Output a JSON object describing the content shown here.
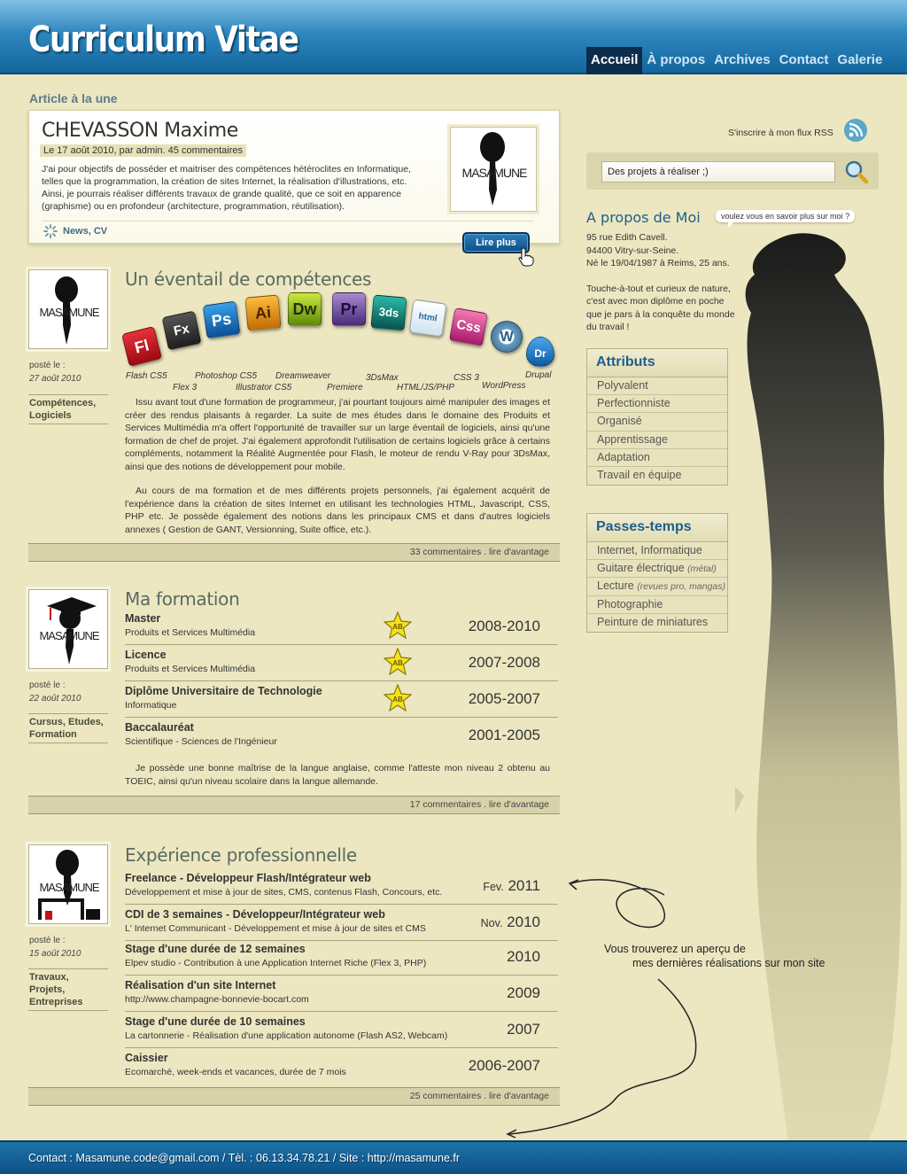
{
  "header": {
    "title": "Curriculum Vitae"
  },
  "nav": [
    {
      "label": "Accueil",
      "active": true
    },
    {
      "label": "À propos"
    },
    {
      "label": "Archives"
    },
    {
      "label": "Contact"
    },
    {
      "label": "Galerie"
    }
  ],
  "featured": {
    "section_label": "Article à la une",
    "name": "CHEVASSON Maxime",
    "meta": "Le 17 août 2010, par admin. 45 commentaires",
    "text": "J'ai pour objectifs de posséder et maitriser des compétences hétéroclites en Informatique, telles que la programmation, la création de sites Internet, la réalisation d'illustrations, etc. Ainsi, je pourrais réaliser différents travaux de grande qualité, que ce soit en apparence (graphisme) ou en profondeur (architecture, programmation, réutilisation).",
    "tags": "News, CV",
    "logo_text": "MASAMUNE",
    "more_button": "Lire plus"
  },
  "posts": {
    "skills": {
      "title": "Un éventail de compétences",
      "posted_label": "posté le :",
      "date": "27 août 2010",
      "category": "Compétences, Logiciels",
      "logo_text": "MASAMUNE",
      "icons": [
        {
          "abbr": "Fl",
          "label": "Flash CS5",
          "color": "#c8101a"
        },
        {
          "abbr": "Fx",
          "label": "Flex 3",
          "color": "#333333"
        },
        {
          "abbr": "Ps",
          "label": "Photoshop CS5",
          "color": "#1c78c8"
        },
        {
          "abbr": "Ai",
          "label": "Illustrator CS5",
          "color": "#e8920c"
        },
        {
          "abbr": "Dw",
          "label": "Dreamweaver",
          "color": "#8fb51a"
        },
        {
          "abbr": "Pr",
          "label": "Premiere",
          "color": "#7a5aa8"
        },
        {
          "abbr": "3ds",
          "label": "3DsMax",
          "color": "#12827a"
        },
        {
          "abbr": "html",
          "label": "HTML/JS/PHP",
          "color": "#7fb4d8"
        },
        {
          "abbr": "Css",
          "label": "CSS 3",
          "color": "#d83a8a"
        },
        {
          "abbr": "W",
          "label": "WordPress",
          "color": "#3f7ea8"
        },
        {
          "abbr": "Dr",
          "label": "Drupal",
          "color": "#1e78c4"
        }
      ],
      "paragraph1": "Issu avant tout d'une formation de programmeur, j'ai pourtant toujours aimé manipuler des images et créer des rendus plaisants à regarder. La suite de mes études dans le domaine des Produits et Services Multimédia m'a offert l'opportunité de travailler sur un large éventail de logiciels, ainsi qu'une formation de chef de projet. J'ai également approfondit l'utilisation de certains logiciels grâce à certains compléments, notamment la Réalité Augmentée pour Flash, le moteur de rendu V-Ray pour 3DsMax, ainsi que des notions de développement pour mobile.",
      "paragraph2": "Au cours de ma formation et de mes différents projets personnels, j'ai également acquérit de l'expérience dans la création de sites Internet en utilisant les technologies HTML, Javascript, CSS, PHP etc.  Je possède également des notions  dans les principaux CMS et dans d'autres logiciels annexes ( Gestion de GANT, Versionning, Suite office, etc.).",
      "footer": "33 commentaires . lire d'avantage"
    },
    "formation": {
      "title": "Ma formation",
      "posted_label": "posté le :",
      "date": "22 août 2010",
      "category": "Cursus, Etudes, Formation",
      "logo_text": "MASAMUNE",
      "rows": [
        {
          "title": "Master",
          "subtitle": "Produits et Services Multimédia",
          "years": "2008-2010",
          "badge": "AB"
        },
        {
          "title": "Licence",
          "subtitle": "Produits et Services Multimédia",
          "years": "2007-2008",
          "badge": "AB"
        },
        {
          "title": "Diplôme Universitaire de Technologie",
          "subtitle": "Informatique",
          "years": "2005-2007",
          "badge": "AB"
        },
        {
          "title": "Baccalauréat",
          "subtitle": "Scientifique - Sciences de l'Ingénieur",
          "years": "2001-2005",
          "badge": ""
        }
      ],
      "paragraph": "Je possède une bonne maîtrise de la langue anglaise, comme l'atteste mon niveau 2 obtenu au TOEIC, ainsi qu'un niveau scolaire dans la langue allemande.",
      "footer": "17 commentaires . lire d'avantage"
    },
    "experience": {
      "title": "Expérience professionnelle",
      "posted_label": "posté le :",
      "date": "15 août 2010",
      "category": "Travaux, Projets, Entreprises",
      "logo_text": "MASAMUNE",
      "rows": [
        {
          "title": "Freelance - Développeur Flash/Intégrateur web",
          "subtitle": "Développement et mise à jour de sites, CMS, contenus Flash, Concours, etc.",
          "month": "Fev.",
          "year": "2011"
        },
        {
          "title": "CDI de 3 semaines - Développeur/Intégrateur web",
          "subtitle": "L' Internet Communicant - Développement et mise à jour de sites et CMS",
          "month": "Nov.",
          "year": "2010"
        },
        {
          "title": "Stage d'une durée de 12 semaines",
          "subtitle": "Elpev studio - Contribution à une Application Internet Riche (Flex 3, PHP)",
          "month": "",
          "year": "2010"
        },
        {
          "title": "Réalisation d'un site Internet",
          "subtitle": "http://www.champagne-bonnevie-bocart.com",
          "month": "",
          "year": "2009"
        },
        {
          "title": "Stage d'une durée de 10 semaines",
          "subtitle": "La cartonnerie - Réalisation d'une application autonome (Flash AS2, Webcam)",
          "month": "",
          "year": "2007"
        },
        {
          "title": "Caissier",
          "subtitle": "Ecomarché, week-ends et vacances, durée de 7 mois",
          "month": "",
          "year": "2006-2007"
        }
      ],
      "footer": "25 commentaires . lire d'avantage"
    }
  },
  "sidebar": {
    "rss_text": "S'inscrire à mon flux RSS",
    "search_value": "Des projets à réaliser ;)",
    "about_title": "A propos de Moi",
    "about_bubble": "voulez vous en savoir plus sur moi ?",
    "about_lines": [
      "95 rue Edith Cavell.",
      "94400 Vitry-sur-Seine.",
      "Né le 19/04/1987 à Reims, 25 ans.",
      "",
      "Touche-à-tout et curieux de nature, c'est avec mon diplôme en poche que je pars à la conquête du monde du travail !"
    ],
    "attributes_title": "Attributs",
    "attributes": [
      "Polyvalent",
      "Perfectionniste",
      "Organisé",
      "Apprentissage",
      "Adaptation",
      "Travail en équipe"
    ],
    "hobbies_title": "Passes-temps",
    "hobbies": [
      {
        "label": "Internet, Informatique",
        "note": ""
      },
      {
        "label": "Guitare électrique",
        "note": "(métal)"
      },
      {
        "label": "Lecture",
        "note": "(revues pro, mangas)"
      },
      {
        "label": "Photographie",
        "note": ""
      },
      {
        "label": "Peinture de miniatures",
        "note": ""
      }
    ]
  },
  "annotation": {
    "line1": "Vous trouverez un aperçu de",
    "line2": "mes dernières réalisations sur mon site"
  },
  "footer": {
    "text": "Contact : Masamune.code@gmail.com  /  Tèl. : 06.13.34.78.21  /  Site : http://masamune.fr"
  },
  "colors": {
    "header_blue": "#13669e",
    "nav_active": "#0c2c4c",
    "page_bg": "#ece7c1",
    "accent_blue": "#1e5e8c"
  }
}
